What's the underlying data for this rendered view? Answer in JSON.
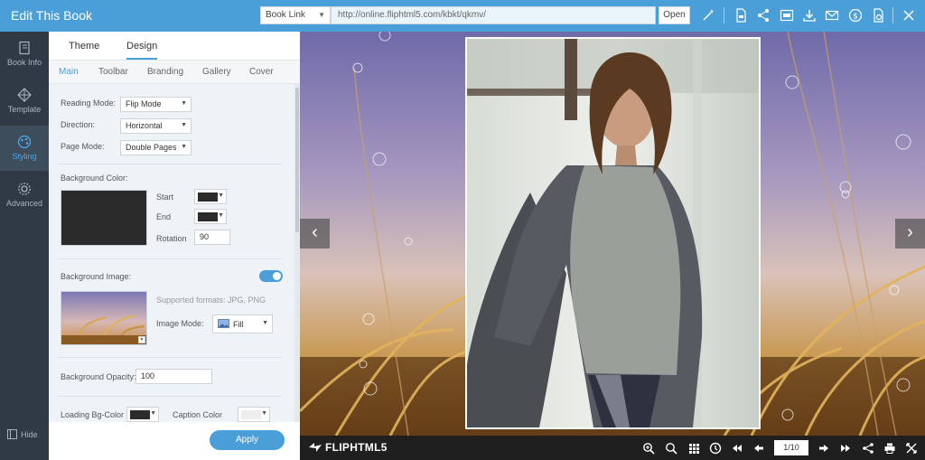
{
  "app": {
    "title": "Edit This Book"
  },
  "topbar": {
    "link_type": "Book Link",
    "link_url": "http://online.fliphtml5.com/kbkt/qkmv/",
    "open_label": "Open",
    "icons": [
      "magic-wand-icon",
      "pdf-icon",
      "share-icon",
      "html5-icon",
      "download-icon",
      "email-icon",
      "dollar-icon",
      "publish-icon",
      "close-icon"
    ]
  },
  "sidebar": {
    "items": [
      {
        "label": "Book Info",
        "icon": "book-info-icon",
        "active": false
      },
      {
        "label": "Template",
        "icon": "template-icon",
        "active": false
      },
      {
        "label": "Styling",
        "icon": "styling-icon",
        "active": true
      },
      {
        "label": "Advanced",
        "icon": "advanced-icon",
        "active": false
      }
    ],
    "hide_label": "Hide"
  },
  "panel": {
    "tabs": [
      {
        "label": "Theme"
      },
      {
        "label": "Design",
        "active": true
      }
    ],
    "sub_tabs": [
      {
        "label": "Main",
        "active": true
      },
      {
        "label": "Toolbar"
      },
      {
        "label": "Branding"
      },
      {
        "label": "Gallery"
      },
      {
        "label": "Cover"
      }
    ],
    "reading_mode": {
      "label": "Reading Mode:",
      "value": "Flip Mode"
    },
    "direction": {
      "label": "Direction:",
      "value": "Horizontal"
    },
    "page_mode": {
      "label": "Page Mode:",
      "value": "Double Pages"
    },
    "background_color": {
      "label": "Background Color:",
      "preview_color": "#2b2b2b",
      "start_label": "Start",
      "start_color": "#2b2b2b",
      "end_label": "End",
      "end_color": "#2b2b2b",
      "rotation_label": "Rotation",
      "rotation_value": "90"
    },
    "background_image": {
      "label": "Background Image:",
      "enabled": true,
      "formats_text": "Supported formats: JPG, PNG",
      "mode_label": "Image Mode:",
      "mode_value": "Fill"
    },
    "background_opacity": {
      "label": "Background Opacity:",
      "value": "100"
    },
    "loading_bg_color": {
      "label": "Loading Bg-Color",
      "color": "#2b2b2b"
    },
    "caption_color": {
      "label": "Caption Color",
      "color": "#eeeeee"
    },
    "apply_label": "Apply"
  },
  "preview": {
    "prev_arrow": "‹",
    "next_arrow": "›"
  },
  "bottombar": {
    "brand": "FLIPHTML5",
    "page_indicator": "1/10",
    "icons": [
      "zoom-in-icon",
      "search-icon",
      "thumbnails-icon",
      "autoplay-icon",
      "first-page-icon",
      "prev-page-icon",
      "next-page-icon",
      "last-page-icon",
      "share-icon",
      "print-icon",
      "fullscreen-icon"
    ]
  },
  "colors": {
    "accent": "#4a9fd9",
    "sidebar_bg": "#2f3a45",
    "toolbar_bg": "#1f1f1f"
  }
}
